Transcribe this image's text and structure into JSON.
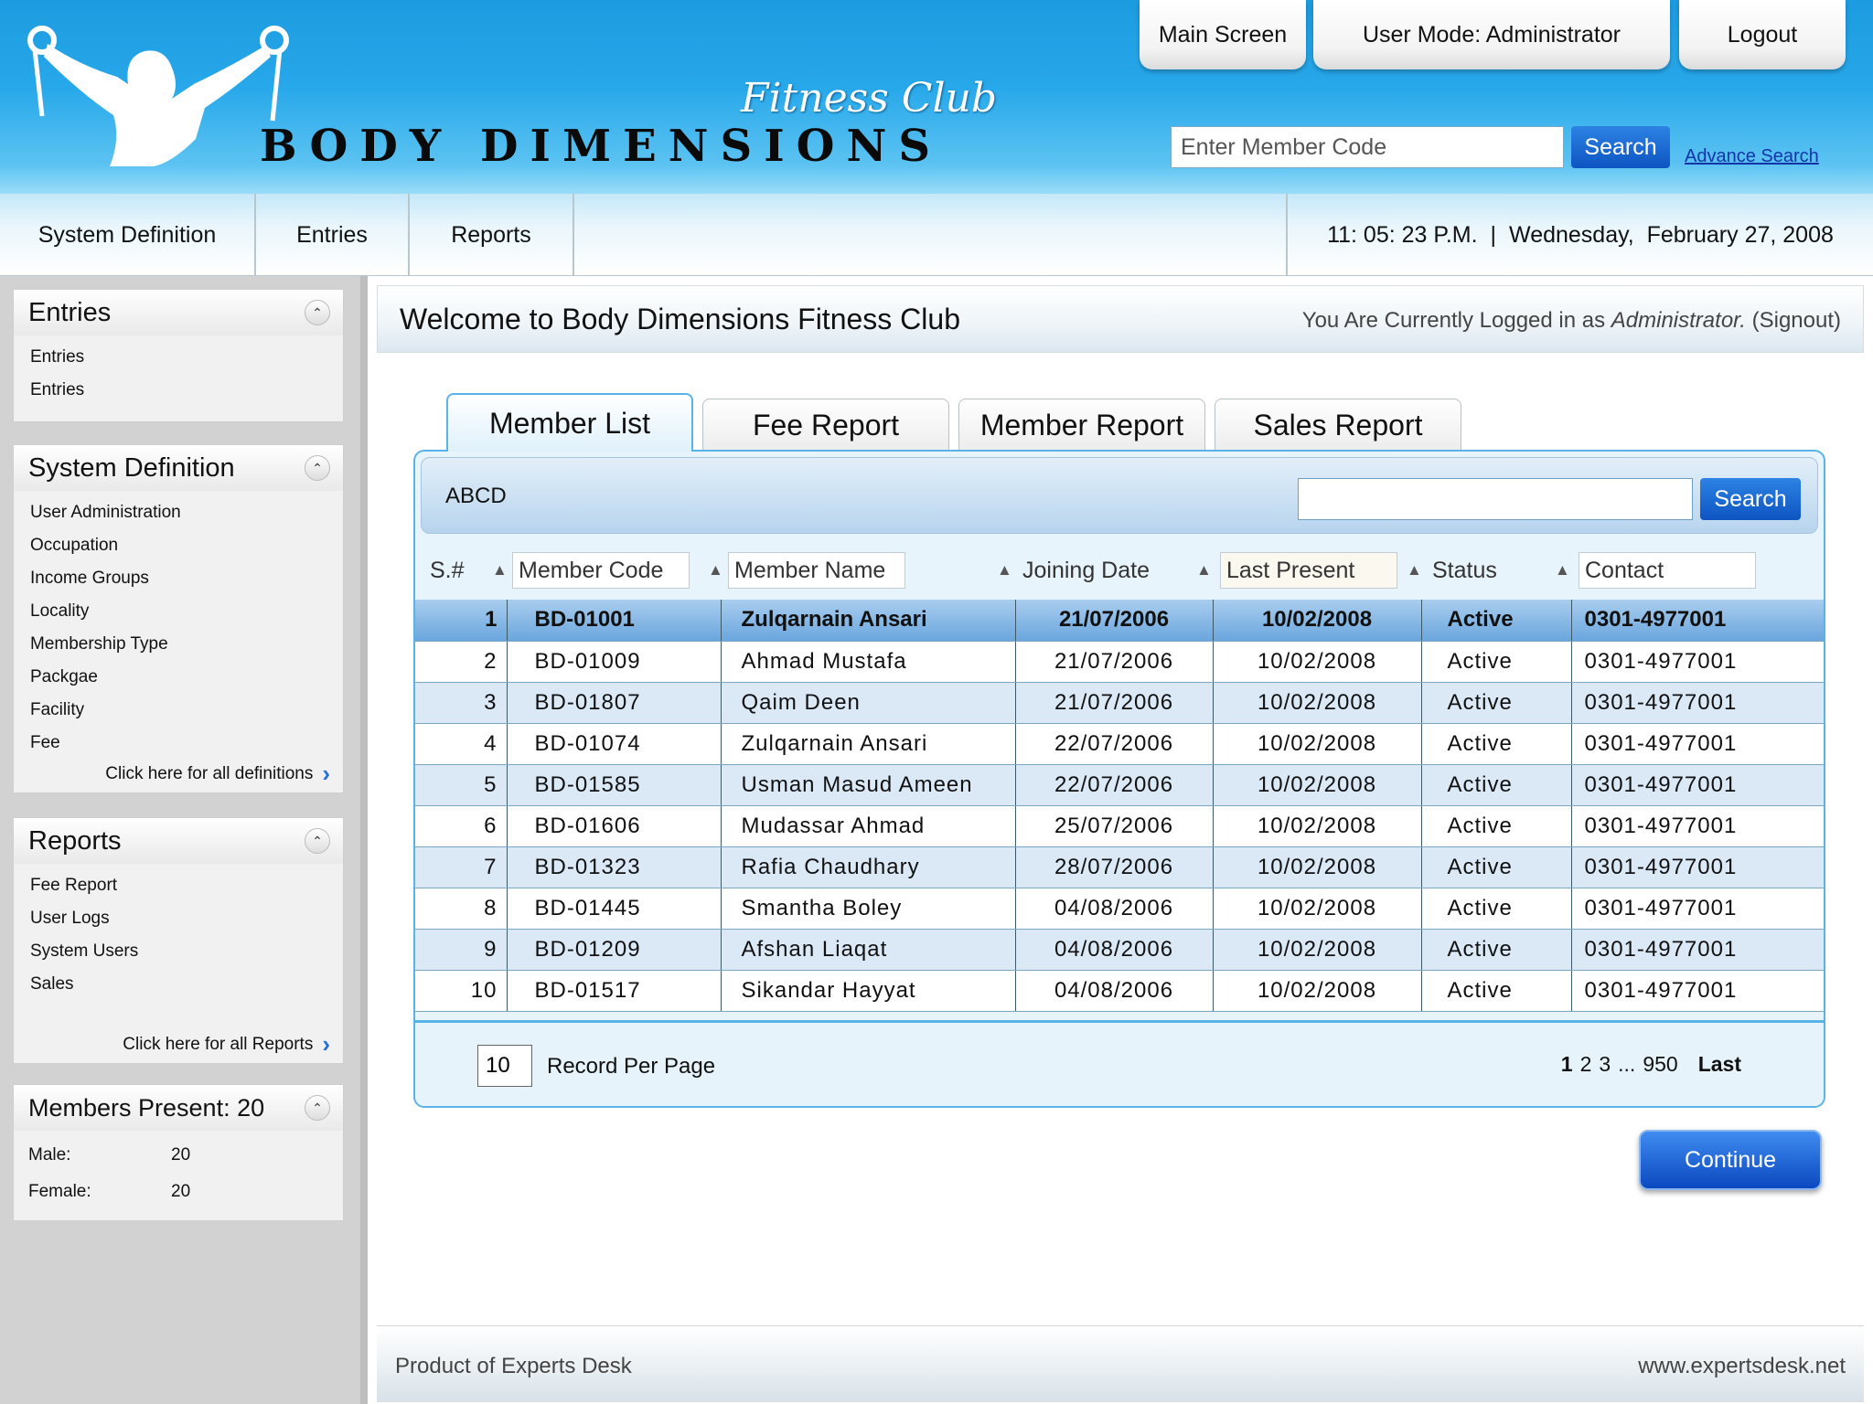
{
  "header": {
    "brand_script": "Fitness Club",
    "brand_name": "BODY DIMENSIONS",
    "main_screen_label": "Main Screen",
    "user_mode_label": "User Mode: Administrator",
    "logout_label": "Logout",
    "search_placeholder": "Enter Member Code",
    "search_button": "Search",
    "advance_search": "Advance Search",
    "brand_color": "#27a8ea"
  },
  "nav": {
    "items": [
      "System Definition",
      "Entries",
      "Reports"
    ],
    "time": "11: 05: 23 P.M.",
    "separator": "|",
    "date": "Wednesday,  February 27, 2008"
  },
  "sidebar": {
    "entries": {
      "title": "Entries",
      "items": [
        "Entries",
        "Entries"
      ]
    },
    "system_definition": {
      "title": "System Definition",
      "items": [
        "User Administration",
        "Occupation",
        "Income Groups",
        "Locality",
        "Membership Type",
        "Packgae",
        "Facility",
        "Fee"
      ],
      "more": "Click here for all definitions"
    },
    "reports": {
      "title": "Reports",
      "items": [
        "Fee Report",
        "User Logs",
        "System Users",
        "Sales"
      ],
      "more": "Click here for all Reports"
    },
    "members": {
      "title": "Members Present: 20",
      "male_label": "Male:",
      "male_value": "20",
      "female_label": "Female:",
      "female_value": "20"
    }
  },
  "main": {
    "welcome": "Welcome to Body Dimensions Fitness Club",
    "login_prefix": "You Are Currently Logged in as ",
    "login_user": "Administrator.",
    "login_suffix": " (Signout)",
    "tabs": [
      "Member List",
      "Fee Report",
      "Member Report",
      "Sales Report"
    ],
    "filter_label": "ABCD",
    "filter_button": "Search",
    "columns": [
      "S.#",
      "Member Code",
      "Member Name",
      "Joining Date",
      "Last Present",
      "Status",
      "Contact"
    ],
    "rows": [
      [
        "1",
        "BD-01001",
        "Zulqarnain Ansari",
        "21/07/2006",
        "10/02/2008",
        "Active",
        "0301-4977001"
      ],
      [
        "2",
        "BD-01009",
        "Ahmad Mustafa",
        "21/07/2006",
        "10/02/2008",
        "Active",
        "0301-4977001"
      ],
      [
        "3",
        "BD-01807",
        "Qaim Deen",
        "21/07/2006",
        "10/02/2008",
        "Active",
        "0301-4977001"
      ],
      [
        "4",
        "BD-01074",
        "Zulqarnain Ansari",
        "22/07/2006",
        "10/02/2008",
        "Active",
        "0301-4977001"
      ],
      [
        "5",
        "BD-01585",
        "Usman Masud Ameen",
        "22/07/2006",
        "10/02/2008",
        "Active",
        "0301-4977001"
      ],
      [
        "6",
        "BD-01606",
        "Mudassar Ahmad",
        "25/07/2006",
        "10/02/2008",
        "Active",
        "0301-4977001"
      ],
      [
        "7",
        "BD-01323",
        "Rafia Chaudhary",
        "28/07/2006",
        "10/02/2008",
        "Active",
        "0301-4977001"
      ],
      [
        "8",
        "BD-01445",
        "Smantha Boley",
        "04/08/2006",
        "10/02/2008",
        "Active",
        "0301-4977001"
      ],
      [
        "9",
        "BD-01209",
        "Afshan Liaqat",
        "04/08/2006",
        "10/02/2008",
        "Active",
        "0301-4977001"
      ],
      [
        "10",
        "BD-01517",
        "Sikandar Hayyat",
        "04/08/2006",
        "10/02/2008",
        "Active",
        "0301-4977001"
      ]
    ],
    "per_page_value": "10",
    "per_page_label": "Record Per Page",
    "pages": [
      "1",
      "2",
      "3",
      "...",
      "950"
    ],
    "last_label": "Last",
    "continue_label": "Continue"
  },
  "footer": {
    "left": "Product of Experts Desk",
    "right": "www.expertsdesk.net"
  }
}
